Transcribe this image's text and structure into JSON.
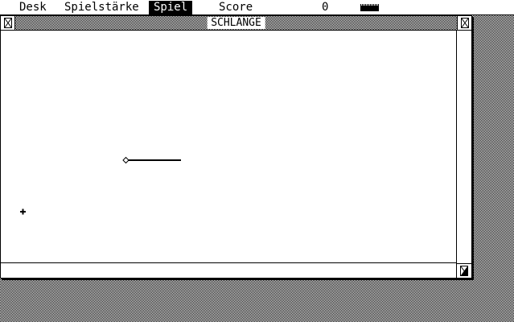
{
  "menubar": {
    "items": [
      {
        "label": "Desk",
        "active": false
      },
      {
        "label": "Spielstärke",
        "active": false
      },
      {
        "label": "Spiel",
        "active": true
      },
      {
        "label": "Score",
        "active": false
      }
    ],
    "score_value": "0"
  },
  "window": {
    "title": "SCHLANGE",
    "close_icon": "close-box-icon",
    "full_icon": "full-box-icon",
    "size_icon": "size-box-icon"
  },
  "game": {
    "snake_head_icon": "diamond",
    "food_icon": "plus"
  }
}
